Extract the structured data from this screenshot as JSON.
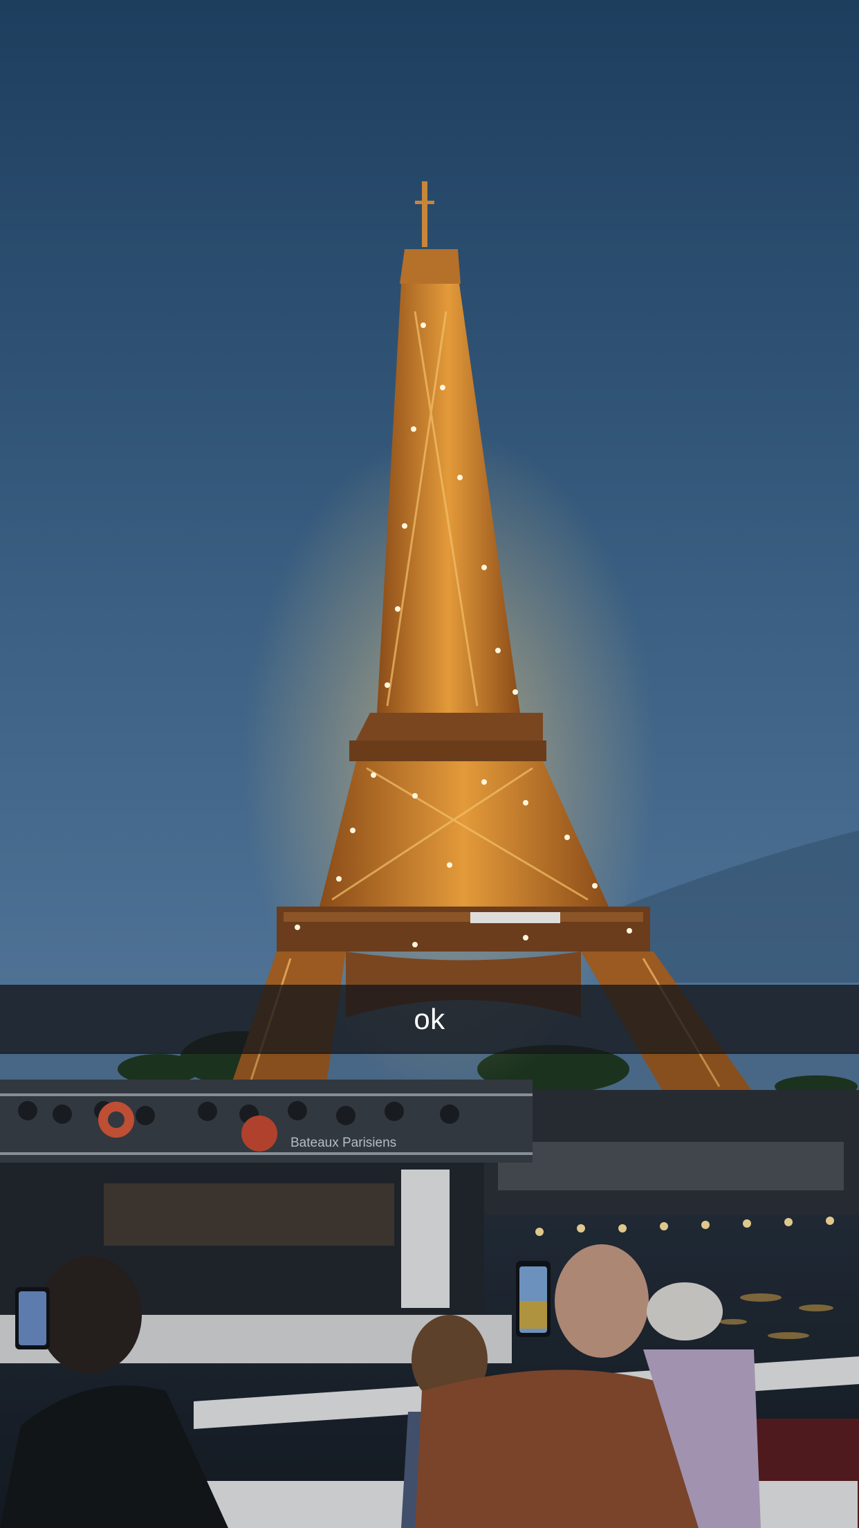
{
  "caption": {
    "text": "ok"
  },
  "scene": {
    "boat_sign": "Bateaux Parisiens"
  },
  "colors": {
    "sky_top": "#1e3e5e",
    "sky_bottom": "#4a6e90",
    "tower_glow": "#e39a3a",
    "caption_bg": "#14161a"
  }
}
